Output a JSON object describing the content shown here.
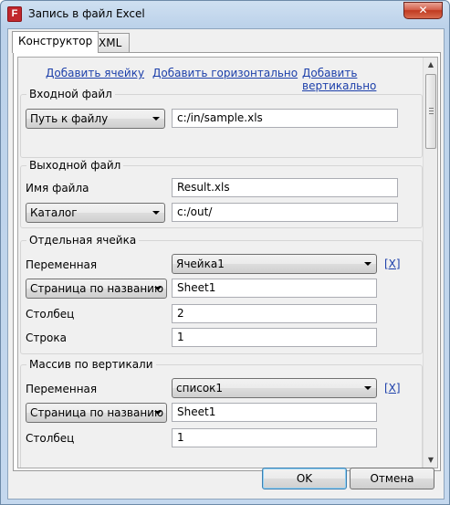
{
  "window": {
    "title": "Запись в файл Excel",
    "app_icon_letter": "F",
    "close_glyph": "✕"
  },
  "tabs": [
    {
      "label": "Конструктор",
      "active": true
    },
    {
      "label": "XML",
      "active": false
    }
  ],
  "toolbar_links": {
    "add_cell": "Добавить ячейку",
    "add_horizontal": "Добавить горизонтально",
    "add_vertical": "Добавить вертикально"
  },
  "input_file": {
    "title": "Входной файл",
    "mode": "Путь к файлу",
    "path": "c:/in/sample.xls"
  },
  "output_file": {
    "title": "Выходной файл",
    "file_name_label": "Имя файла",
    "file_name": "Result.xls",
    "folder_mode": "Каталог",
    "folder": "c:/out/"
  },
  "single_cell": {
    "title": "Отдельная ячейка",
    "variable_label": "Переменная",
    "variable": "Ячейка1",
    "remove_link": "[X]",
    "sheet_mode": "Страница по названию",
    "sheet": "Sheet1",
    "column_label": "Столбец",
    "column": "2",
    "row_label": "Строка",
    "row": "1"
  },
  "vertical_array": {
    "title": "Массив по вертикали",
    "variable_label": "Переменная",
    "variable": "список1",
    "remove_link": "[X]",
    "sheet_mode": "Страница по названию",
    "sheet": "Sheet1",
    "column_label": "Столбец",
    "column": "1"
  },
  "buttons": {
    "ok": "OK",
    "cancel": "Отмена"
  },
  "colors": {
    "link": "#1c3faa",
    "close_button": "#c03a20"
  }
}
